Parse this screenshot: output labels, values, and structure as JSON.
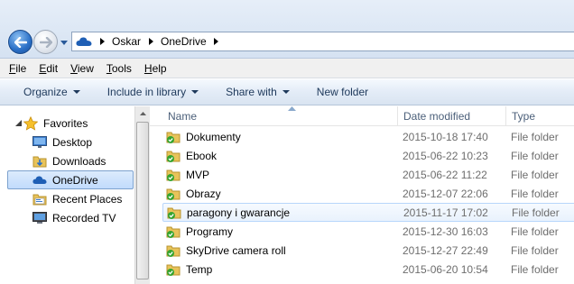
{
  "address_bar": {
    "breadcrumbs": [
      "Oskar",
      "OneDrive"
    ]
  },
  "menu": {
    "items": [
      {
        "label": "File",
        "accel": "F",
        "rest": "ile"
      },
      {
        "label": "Edit",
        "accel": "E",
        "rest": "dit"
      },
      {
        "label": "View",
        "accel": "V",
        "rest": "iew"
      },
      {
        "label": "Tools",
        "accel": "T",
        "rest": "ools"
      },
      {
        "label": "Help",
        "accel": "H",
        "rest": "elp"
      }
    ]
  },
  "toolbar": {
    "organize": "Organize",
    "include_in_library": "Include in library",
    "share_with": "Share with",
    "new_folder": "New folder"
  },
  "nav_pane": {
    "favorites": "Favorites",
    "items": [
      {
        "label": "Desktop",
        "icon": "desktop-icon"
      },
      {
        "label": "Downloads",
        "icon": "downloads-icon"
      },
      {
        "label": "OneDrive",
        "icon": "onedrive-icon",
        "selected": true
      },
      {
        "label": "Recent Places",
        "icon": "recent-places-icon"
      },
      {
        "label": "Recorded TV",
        "icon": "recorded-tv-icon"
      }
    ]
  },
  "file_list": {
    "columns": {
      "name": "Name",
      "date_modified": "Date modified",
      "type": "Type"
    },
    "rows": [
      {
        "name": "Dokumenty",
        "date": "2015-10-18 17:40",
        "type": "File folder"
      },
      {
        "name": "Ebook",
        "date": "2015-06-22 10:23",
        "type": "File folder"
      },
      {
        "name": "MVP",
        "date": "2015-06-22 11:22",
        "type": "File folder"
      },
      {
        "name": "Obrazy",
        "date": "2015-12-07 22:06",
        "type": "File folder"
      },
      {
        "name": "paragony i gwarancje",
        "date": "2015-11-17 17:02",
        "type": "File folder",
        "hover": true
      },
      {
        "name": "Programy",
        "date": "2015-12-30 16:03",
        "type": "File folder"
      },
      {
        "name": "SkyDrive camera roll",
        "date": "2015-12-27 22:49",
        "type": "File folder"
      },
      {
        "name": "Temp",
        "date": "2015-06-20 10:54",
        "type": "File folder"
      }
    ]
  },
  "colors": {
    "accent": "#2a6fc6",
    "folder_yellow": "#e8c35a",
    "sync_green": "#35a42f",
    "selection": "#c1dbfc"
  }
}
